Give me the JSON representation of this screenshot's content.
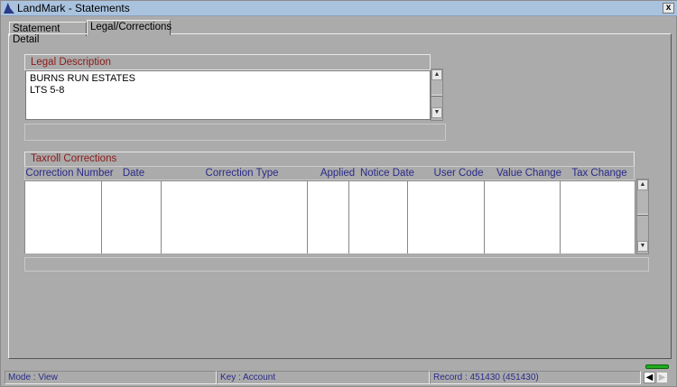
{
  "window": {
    "title": "LandMark - Statements",
    "close": "x"
  },
  "tabs": [
    {
      "label": "Statement Detail"
    },
    {
      "label": "Legal/Corrections"
    }
  ],
  "legal": {
    "title": "Legal Description",
    "lines": [
      "BURNS RUN ESTATES",
      "LTS 5-8"
    ]
  },
  "taxroll": {
    "title": "Taxroll Corrections",
    "columns": [
      "Correction Number",
      "Date",
      "Correction Type",
      "Applied",
      "Notice Date",
      "User Code",
      "Value Change",
      "Tax Change"
    ]
  },
  "status": {
    "mode": "Mode : View",
    "key": "Key : Account",
    "record": "Record : 451430 (451430)"
  },
  "colors": {
    "accent": "#8b1a1a",
    "header_text": "#2a2a8a",
    "indicator": "#22aa22"
  }
}
